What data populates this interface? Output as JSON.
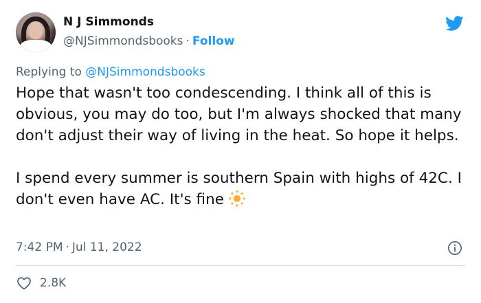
{
  "author": {
    "name": "N J Simmonds",
    "handle": "@NJSimmondsbooks",
    "separator": "·",
    "follow_label": "Follow"
  },
  "reply_context": {
    "prefix": "Replying to",
    "mention": "@NJSimmondsbooks"
  },
  "tweet": {
    "paragraph_1": "Hope that wasn't too condescending. I think all of this is obvious, you may do too, but I'm always shocked that many don't adjust their way of living in the heat. So hope it helps.",
    "paragraph_2": "I spend every summer is southern Spain with highs of 42C. I don't even have AC. It's fine",
    "emoji_icon": "sun-icon"
  },
  "meta": {
    "time": "7:42 PM",
    "separator": "·",
    "date": "Jul 11, 2022"
  },
  "engagement": {
    "likes": "2.8K"
  },
  "icons": {
    "logo": "twitter-bird-icon",
    "info": "info-icon",
    "like": "heart-icon"
  },
  "colors": {
    "accent": "#1d9bf0",
    "text": "#0f1419",
    "secondary": "#536471",
    "sun": "#ffac33",
    "divider": "#cfd9de"
  }
}
